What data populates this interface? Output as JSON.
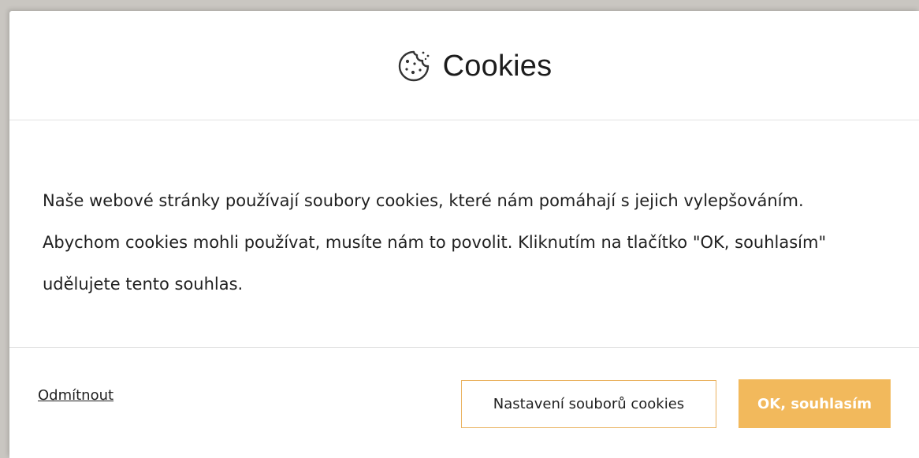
{
  "dialog": {
    "title": "Cookies",
    "title_icon": "cookie-icon",
    "message": "Naše webové stránky používají soubory cookies, které nám pomáhají s jejich vylepšováním. Abychom cookies mohli používat, musíte nám to povolit. Kliknutím na tlačítko \"OK, souhlasím\" udělujete tento souhlas."
  },
  "footer": {
    "decline_label": "Odmítnout",
    "settings_label": "Nastavení souborů cookies",
    "accept_label": "OK, souhlasím"
  },
  "colors": {
    "accent": "#f2b95c",
    "accent_border": "#eab25f",
    "backdrop": "#c9c6c1",
    "text": "#1f1f1f"
  }
}
